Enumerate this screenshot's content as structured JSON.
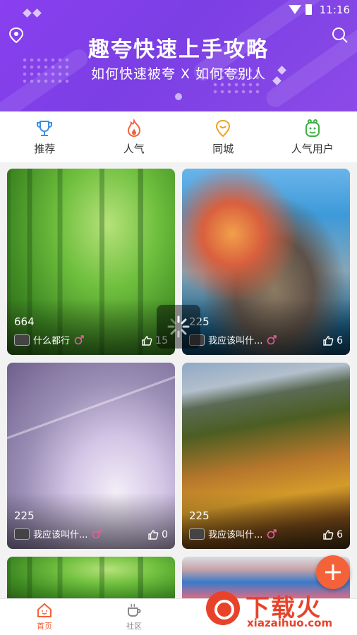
{
  "status_bar": {
    "time": "11:16"
  },
  "banner": {
    "title": "趣夸快速上手攻略",
    "subtitle": "如何快速被夸 X 如何夸别人",
    "colors": {
      "start": "#8a3ff0",
      "end": "#8c4ae8"
    }
  },
  "categories": [
    {
      "label": "推荐",
      "icon": "trophy-icon",
      "color": "#3d8fe0"
    },
    {
      "label": "人气",
      "icon": "flame-icon",
      "color": "#f4623a"
    },
    {
      "label": "同城",
      "icon": "location-pin-icon",
      "color": "#f0a020"
    },
    {
      "label": "人气用户",
      "icon": "smiley-badge-icon",
      "color": "#3cb043"
    }
  ],
  "cards": [
    {
      "count": "664",
      "username": "什么都行",
      "gender": "male",
      "likes": "15",
      "image": "bamboo-forest"
    },
    {
      "count": "225",
      "username": "我应该叫什...",
      "gender": "male",
      "likes": "6",
      "image": "coastal-village"
    },
    {
      "count": "225",
      "username": "我应该叫什...",
      "gender": "male",
      "likes": "0",
      "image": "winter-trees"
    },
    {
      "count": "225",
      "username": "我应该叫什...",
      "gender": "male",
      "likes": "6",
      "image": "autumn-mountain"
    },
    {
      "image": "bamboo-forest"
    },
    {
      "image": "beach-portrait"
    }
  ],
  "bottom_nav": {
    "tabs": [
      {
        "label": "首页",
        "icon": "home-icon",
        "active": true
      },
      {
        "label": "社区",
        "icon": "coffee-cup-icon",
        "active": false
      }
    ]
  },
  "watermark": {
    "text": "下载火",
    "url": "xiazaihuo.com"
  },
  "accent_color": "#f4623a"
}
